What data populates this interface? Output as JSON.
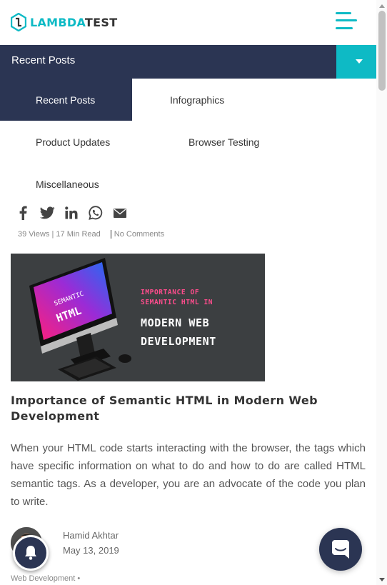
{
  "brand": {
    "name_part1": "LAMBDA",
    "name_part2": "TEST",
    "logo_icon": "lambdatest-logo-icon",
    "accent": "#0ebac5",
    "dark": "#2b3553"
  },
  "header": {
    "menu_icon": "hamburger-menu-icon"
  },
  "dropdown": {
    "label": "Recent Posts",
    "toggle_icon": "chevron-down-icon"
  },
  "categories": [
    {
      "label": "Recent Posts",
      "active": true
    },
    {
      "label": "Infographics",
      "active": false
    },
    {
      "label": "Product Updates",
      "active": false
    },
    {
      "label": "Browser Testing",
      "active": false
    },
    {
      "label": "Miscellaneous",
      "active": false
    }
  ],
  "share": [
    "facebook-icon",
    "twitter-icon",
    "linkedin-icon",
    "whatsapp-icon",
    "email-icon"
  ],
  "post": {
    "meta": "39 Views | 17 Min Read",
    "comments": "No Comments",
    "image": {
      "screen_line1": "SEMANTIC",
      "screen_line2": "HTML",
      "overlay_line1": "IMPORTANCE OF",
      "overlay_line2": "SEMANTIC HTML IN",
      "overlay_line3": "MODERN WEB",
      "overlay_line4": "DEVELOPMENT"
    },
    "title": "Importance of Semantic HTML in Modern Web Development",
    "excerpt": "When your HTML code starts interacting with the browser, the tags which have specific information on what to do and how to do are called HTML semantic tags. As a developer, you are an advocate of the code you plan to write.",
    "author": "Hamid Akhtar",
    "date": "May 13, 2019",
    "category": "Web Development •"
  },
  "widgets": {
    "bell_icon": "notification-bell-icon",
    "chat_icon": "chat-bubble-icon"
  }
}
